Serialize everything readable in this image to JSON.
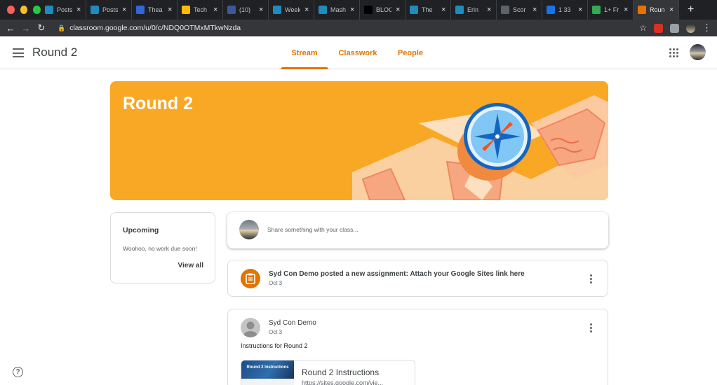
{
  "browser": {
    "tabs": [
      {
        "label": "Posts",
        "icon": "wordpress-icon",
        "color": "#1e8cbe"
      },
      {
        "label": "Posts",
        "icon": "wordpress-icon",
        "color": "#1e8cbe"
      },
      {
        "label": "Thea",
        "icon": "site-icon",
        "color": "#3367d6"
      },
      {
        "label": "Tech",
        "icon": "drive-icon",
        "color": "#fbbc04"
      },
      {
        "label": "(10)",
        "icon": "facebook-icon",
        "color": "#3b5998"
      },
      {
        "label": "Week",
        "icon": "wordpress-icon",
        "color": "#1e8cbe"
      },
      {
        "label": "Mash",
        "icon": "wordpress-icon",
        "color": "#1e8cbe"
      },
      {
        "label": "BLOG",
        "icon": "wix-icon",
        "color": "#000000"
      },
      {
        "label": "The",
        "icon": "wordpress-icon",
        "color": "#1e8cbe"
      },
      {
        "label": "Erin",
        "icon": "wordpress-icon",
        "color": "#1e8cbe"
      },
      {
        "label": "Scor",
        "icon": "scorm-icon",
        "color": "#5f6368"
      },
      {
        "label": "1 33",
        "icon": "bing-icon",
        "color": "#1a73e8"
      },
      {
        "label": "1+ Fr",
        "icon": "px-icon",
        "color": "#34a853"
      },
      {
        "label": "Roun",
        "icon": "classroom-icon",
        "color": "#e37400"
      }
    ],
    "url": "classroom.google.com/u/0/c/NDQ0OTMxMTkwNzda"
  },
  "header": {
    "class_title": "Round 2",
    "tabs": [
      "Stream",
      "Classwork",
      "People"
    ],
    "active_tab": "Stream",
    "accent": "#e37400"
  },
  "banner": {
    "title": "Round 2",
    "color": "#f9a825"
  },
  "upcoming": {
    "title": "Upcoming",
    "message": "Woohoo, no work due soon!",
    "link": "View all"
  },
  "share": {
    "placeholder": "Share something with your class..."
  },
  "posts": [
    {
      "title": "Syd Con Demo posted a new assignment: Attach your Google Sites link here",
      "date": "Oct 3"
    },
    {
      "author": "Syd Con Demo",
      "date": "Oct 3",
      "body": "Instructions for Round 2",
      "attachment": {
        "thumb_text": "Round 2 Instructions",
        "title": "Round 2 Instructions",
        "url": "https://sites.google.com/vie..."
      }
    }
  ]
}
